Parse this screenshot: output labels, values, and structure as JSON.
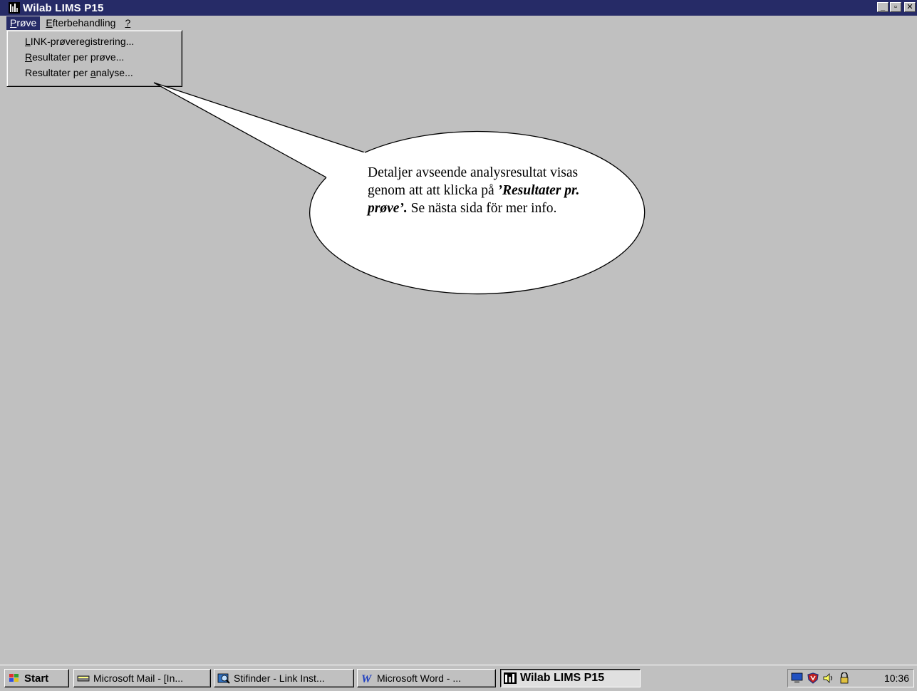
{
  "window": {
    "title": "Wilab LIMS P15",
    "controls": [
      "minimize",
      "restore",
      "close"
    ]
  },
  "menubar": {
    "items": [
      {
        "label": "Prøve",
        "mnemonic": "P",
        "rest": "røve"
      },
      {
        "label": "Efterbehandling",
        "mnemonic": "E",
        "rest": "fterbehandling"
      },
      {
        "label": "?",
        "mnemonic": "?",
        "rest": ""
      }
    ]
  },
  "dropdown": {
    "items": [
      {
        "label": "LINK-prøveregistrering...",
        "pre": "",
        "mnemonic": "L",
        "post": "INK-prøveregistrering..."
      },
      {
        "label": "Resultater per prøve...",
        "pre": "",
        "mnemonic": "R",
        "post": "esultater per prøve..."
      },
      {
        "label": "Resultater per analyse...",
        "pre": "Resultater per ",
        "mnemonic": "a",
        "post": "nalyse..."
      }
    ]
  },
  "callout": {
    "text1": "Detaljer avseende analysresultat visas genom att att klicka på ",
    "emphasis": "’Resultater pr. prøve’.",
    "text2": " Se nästa sida för mer info."
  },
  "taskbar": {
    "start_label": "Start",
    "buttons": [
      {
        "label": "Microsoft Mail - [In...",
        "icon": "mail-icon"
      },
      {
        "label": "Stifinder - Link Inst...",
        "icon": "explorer-icon"
      },
      {
        "label": "Microsoft Word - ...",
        "icon": "word-icon"
      },
      {
        "label": "Wilab LIMS P15",
        "icon": "wilab-icon",
        "active": true
      }
    ],
    "clock": "10:36"
  },
  "colors": {
    "titlebar": "#262b67",
    "desktop": "#c0c0c0"
  }
}
